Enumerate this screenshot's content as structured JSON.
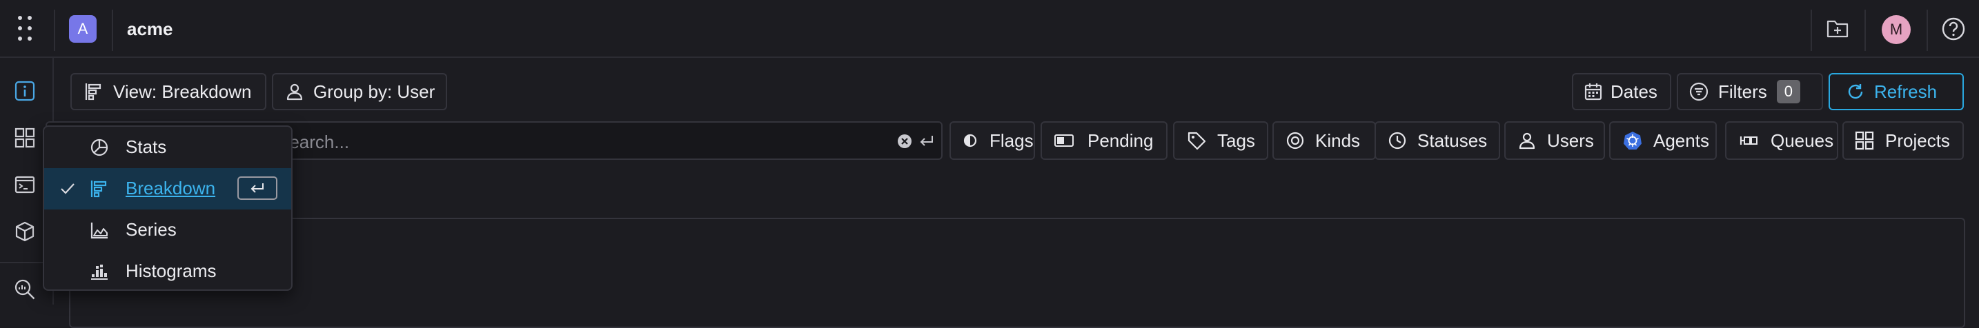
{
  "header": {
    "org_initial": "A",
    "org_name": "acme",
    "user_initial": "M"
  },
  "toolbar": {
    "view_label": "View: Breakdown",
    "group_label": "Group by: User",
    "dates_label": "Dates",
    "filters_label": "Filters",
    "filters_count": "0",
    "refresh_label": "Refresh"
  },
  "search": {
    "placeholder": "Search..."
  },
  "filters": [
    "Flags",
    "Pending",
    "Tags",
    "Kinds",
    "Statuses",
    "Users",
    "Agents",
    "Queues",
    "Projects"
  ],
  "view_menu": {
    "items": [
      "Stats",
      "Breakdown",
      "Series",
      "Histograms"
    ],
    "selected": "Breakdown"
  },
  "colors": {
    "accent": "#3cb4ee",
    "org_avatar": "#7777e8",
    "user_avatar": "#e6a3c2",
    "selected_bg": "#15344a"
  }
}
